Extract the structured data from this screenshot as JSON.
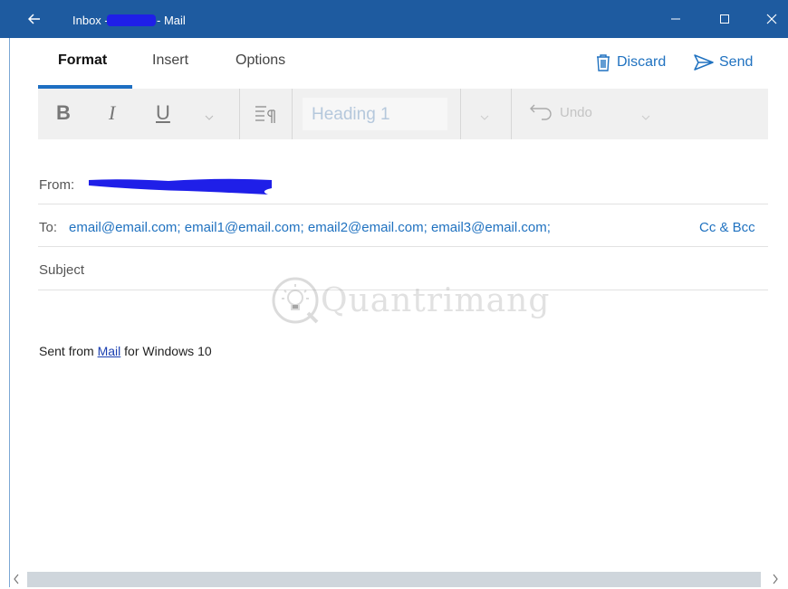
{
  "window": {
    "title_prefix": "Inbox -",
    "title_suffix": "- Mail"
  },
  "tabs": [
    {
      "label": "Format",
      "active": true
    },
    {
      "label": "Insert",
      "active": false
    },
    {
      "label": "Options",
      "active": false
    }
  ],
  "actions": {
    "discard_label": "Discard",
    "send_label": "Send"
  },
  "ribbon": {
    "bold": "B",
    "italic": "I",
    "underline": "U",
    "style_value": "Heading 1",
    "undo_label": "Undo"
  },
  "compose": {
    "from_label": "From:",
    "to_label": "To:",
    "to_value": "email@email.com; email1@email.com; email2@email.com; email3@email.com;",
    "cc_bcc_label": "Cc & Bcc",
    "subject_placeholder": "Subject",
    "signature_prefix": "Sent from",
    "signature_link": "Mail",
    "signature_suffix": "for Windows 10"
  },
  "watermark": "Quantrimang",
  "colors": {
    "titlebar": "#1e5ba0",
    "accent": "#1e6fc2",
    "link": "#2072c0"
  }
}
